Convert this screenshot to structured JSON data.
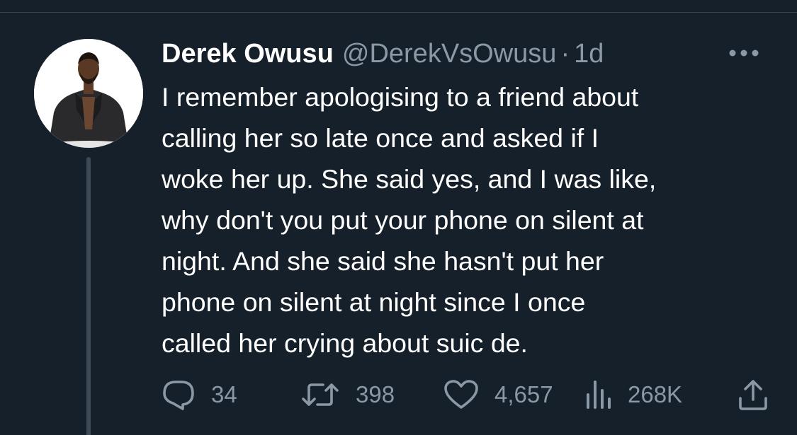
{
  "tweet": {
    "author": {
      "display_name": "Derek Owusu",
      "handle": "@DerekVsOwusu",
      "avatar": "profile-photo"
    },
    "separator": "·",
    "time": "1d",
    "more_icon": "more-horizontal-icon",
    "text_lines": [
      "I remember apologising to a friend about",
      "calling her so late once and asked if I",
      "woke her up. She said yes, and I was like,",
      "why don't you put your phone on silent at",
      "night. And she said she hasn't put her",
      "phone on silent at night since I once",
      "called her crying about suic de."
    ],
    "actions": {
      "replies": {
        "icon": "reply-icon",
        "count": "34"
      },
      "retweets": {
        "icon": "retweet-icon",
        "count": "398"
      },
      "likes": {
        "icon": "heart-icon",
        "count": "4,657"
      },
      "views": {
        "icon": "analytics-icon",
        "count": "268K"
      },
      "share": {
        "icon": "share-icon"
      }
    }
  },
  "colors": {
    "background": "#15202b",
    "text": "#ffffff",
    "secondary_text": "#8b98a5",
    "divider": "#38444d",
    "thread_line": "#3d4a55"
  }
}
